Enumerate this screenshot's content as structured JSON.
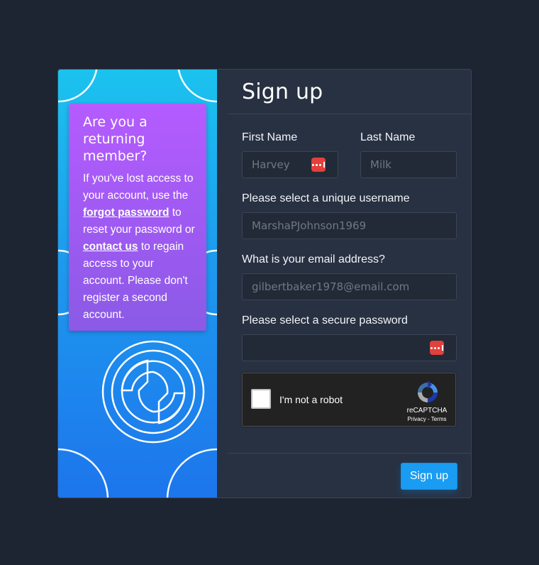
{
  "promo": {
    "title": "Are you a returning member?",
    "text_1": "If you've lost access to your account, use the ",
    "forgot_link": "forgot password",
    "text_2": " to reset your password or ",
    "contact_link": "contact us",
    "text_3": " to regain access to your account. Please don't register a second account."
  },
  "form": {
    "title": "Sign up",
    "first_name_label": "First Name",
    "first_name_placeholder": "Harvey",
    "last_name_label": "Last Name",
    "last_name_placeholder": "Milk",
    "username_label": "Please select a unique username",
    "username_placeholder": "MarshaPJohnson1969",
    "email_label": "What is your email address?",
    "email_placeholder": "gilbertbaker1978@email.com",
    "password_label": "Please select a secure password",
    "password_placeholder": ""
  },
  "captcha": {
    "label": "I'm not a robot",
    "brand": "reCAPTCHA",
    "privacy": "Privacy",
    "separator": " - ",
    "terms": "Terms"
  },
  "submit_label": "Sign up",
  "colors": {
    "page_bg": "#1c2531",
    "card_bg": "#283142",
    "accent": "#199cf1",
    "promo_top": "#b55bff",
    "password_manager_icon": "#e2403c"
  },
  "icons": [
    "password-manager-icon",
    "recaptcha-logo-icon",
    "brand-logo-pattern"
  ]
}
